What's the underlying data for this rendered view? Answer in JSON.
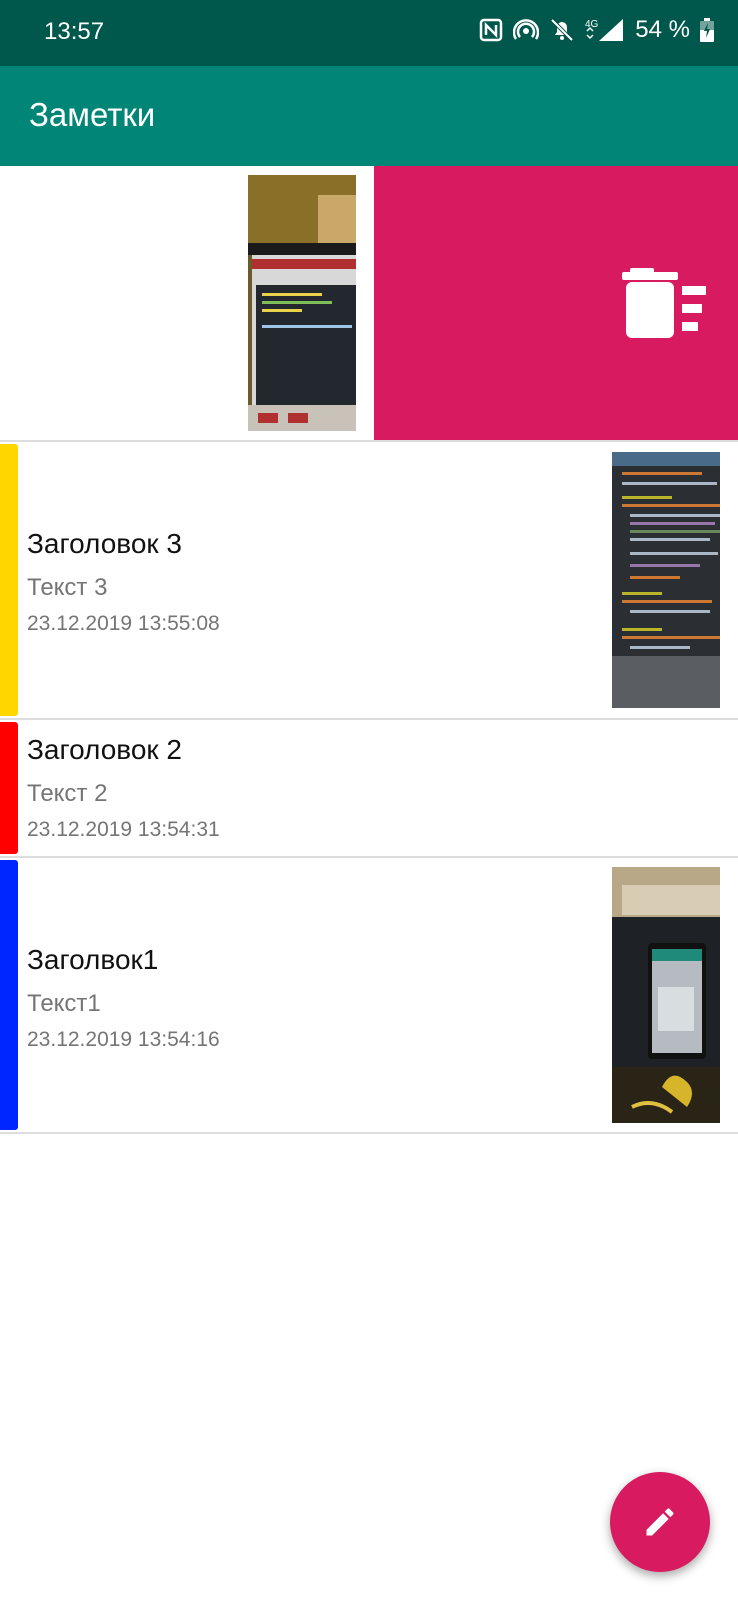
{
  "status": {
    "time": "13:57",
    "battery": "54 %",
    "network": "4G"
  },
  "app_bar": {
    "title": "Заметки"
  },
  "colors": {
    "app_bar": "#008577",
    "status_bar": "#00574b",
    "accent": "#d81b60",
    "yellow": "#ffd600",
    "red": "#ff0000",
    "blue": "#0026ff"
  },
  "notes": [
    {
      "title": "Заголовок 3",
      "text": "Текст 3",
      "date": "23.12.2019 13:55:08",
      "color": "#ffd600",
      "has_image": true
    },
    {
      "title": "Заголовок 2",
      "text": "Текст 2",
      "date": "23.12.2019 13:54:31",
      "color": "#ff0000",
      "has_image": false
    },
    {
      "title": "Заголвок1",
      "text": "Текст1",
      "date": "23.12.2019 13:54:16",
      "color": "#0026ff",
      "has_image": true
    }
  ],
  "icons": {
    "delete": "delete-sweep-icon",
    "fab": "edit-pencil-icon"
  }
}
